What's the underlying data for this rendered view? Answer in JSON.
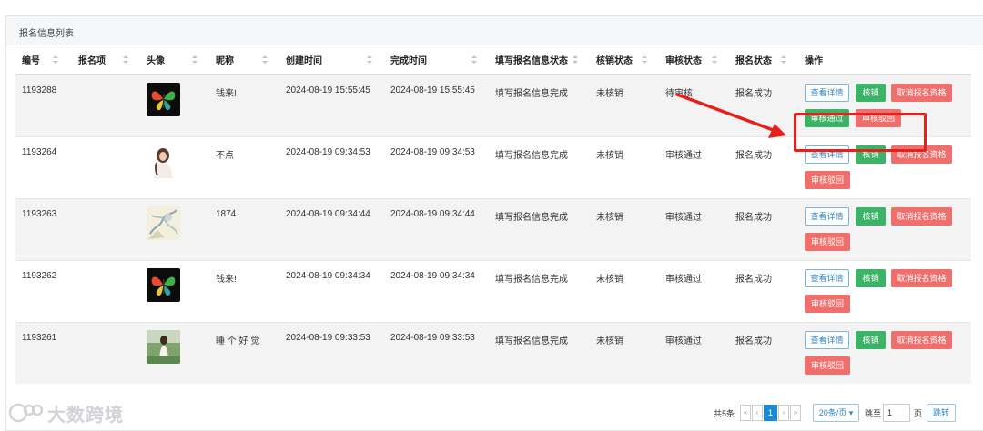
{
  "panel": {
    "title": "报名信息列表"
  },
  "columns": [
    {
      "label": "编号",
      "sortable": true
    },
    {
      "label": "报名项",
      "sortable": true
    },
    {
      "label": "头像",
      "sortable": true
    },
    {
      "label": "昵称",
      "sortable": true
    },
    {
      "label": "创建时间",
      "sortable": true
    },
    {
      "label": "完成时间",
      "sortable": true
    },
    {
      "label": "填写报名信息状态",
      "sortable": true
    },
    {
      "label": "核销状态",
      "sortable": true
    },
    {
      "label": "审核状态",
      "sortable": true
    },
    {
      "label": "报名状态",
      "sortable": true
    },
    {
      "label": "操作",
      "sortable": false
    }
  ],
  "actions": {
    "detail": "查看详情",
    "verify": "核销",
    "cancel": "取消报名资格",
    "pass": "审核通过",
    "reject": "审核驳回"
  },
  "rows": [
    {
      "id": "1193288",
      "item": "",
      "avatar": "butterfly",
      "nickname": "钱来!",
      "created": "2024-08-19 15:55:45",
      "finished": "2024-08-19 15:55:45",
      "fill_status": "填写报名信息完成",
      "verify_status": "未核销",
      "audit_status": "待审核",
      "signup_status": "报名成功"
    },
    {
      "id": "1193264",
      "item": "",
      "avatar": "girl-portrait",
      "nickname": "不点",
      "created": "2024-08-19 09:34:53",
      "finished": "2024-08-19 09:34:53",
      "fill_status": "填写报名信息完成",
      "verify_status": "未核销",
      "audit_status": "审核通过",
      "signup_status": "报名成功"
    },
    {
      "id": "1193263",
      "item": "",
      "avatar": "sketch-photo",
      "nickname": "1874",
      "created": "2024-08-19 09:34:44",
      "finished": "2024-08-19 09:34:44",
      "fill_status": "填写报名信息完成",
      "verify_status": "未核销",
      "audit_status": "审核通过",
      "signup_status": "报名成功"
    },
    {
      "id": "1193262",
      "item": "",
      "avatar": "butterfly",
      "nickname": "钱来!",
      "created": "2024-08-19 09:34:34",
      "finished": "2024-08-19 09:34:34",
      "fill_status": "填写报名信息完成",
      "verify_status": "未核销",
      "audit_status": "审核通过",
      "signup_status": "报名成功"
    },
    {
      "id": "1193261",
      "item": "",
      "avatar": "outdoor-photo",
      "nickname": "睡 个 好 觉",
      "created": "2024-08-19 09:33:53",
      "finished": "2024-08-19 09:33:53",
      "fill_status": "填写报名信息完成",
      "verify_status": "未核销",
      "audit_status": "审核通过",
      "signup_status": "报名成功"
    }
  ],
  "pagination": {
    "total_text": "共5条",
    "first": "«",
    "prev": "‹",
    "current": "1",
    "next": "›",
    "last": "»",
    "page_size": "20条/页",
    "jump_label": "跳至",
    "jump_value": "1",
    "page_unit": "页",
    "jump_button": "跳转"
  },
  "watermark": "大数跨境",
  "colors": {
    "primary": "#1b8ad6",
    "success": "#3cb366",
    "danger": "#ef6f6c",
    "highlight": "#e8201c"
  }
}
